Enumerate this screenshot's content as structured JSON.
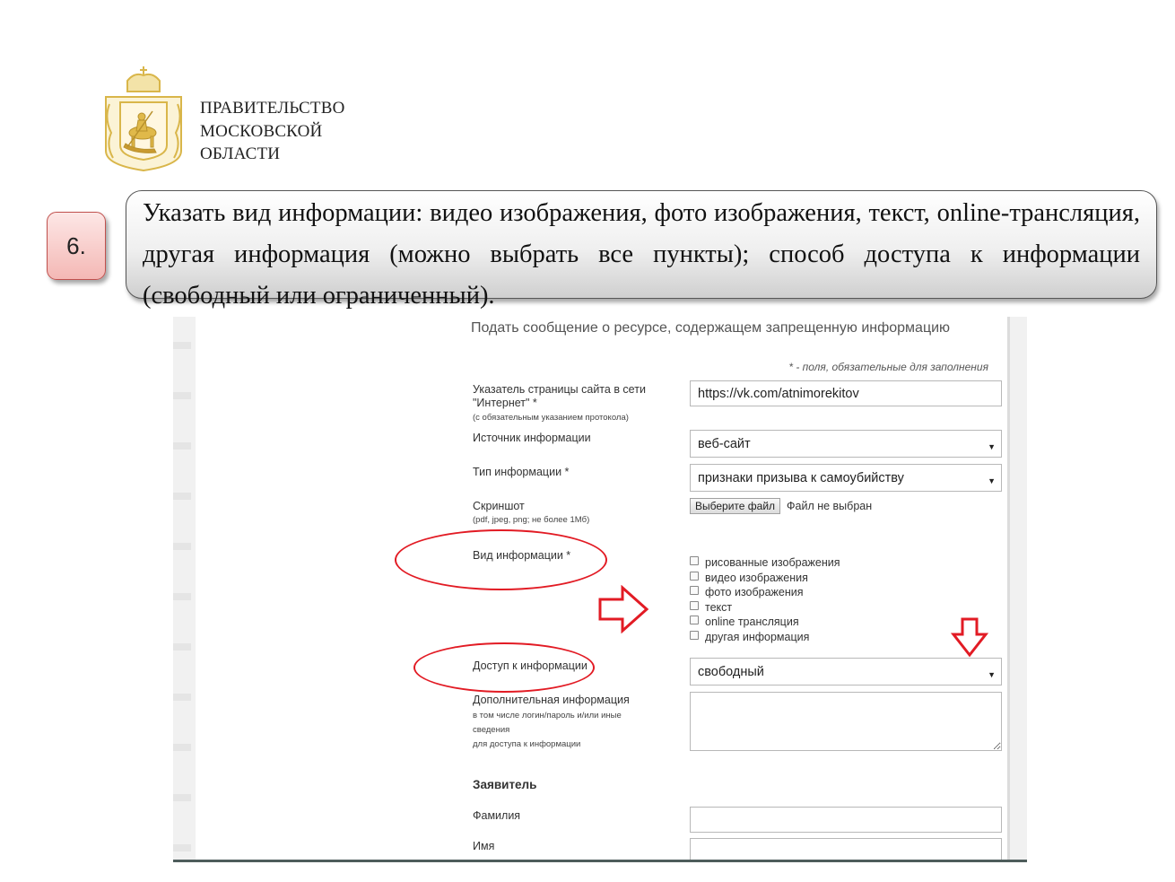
{
  "header": {
    "org_lines": [
      "ПРАВИТЕЛЬСТВО",
      "МОСКОВСКОЙ",
      "ОБЛАСТИ"
    ]
  },
  "step": {
    "number": "6.",
    "instruction": "Указать вид информации: видео изображения, фото изображения, текст, online-трансляция, другая информация (можно выбрать все пункты); способ доступа к информации (свободный или ограниченный)."
  },
  "form": {
    "title": "Подать сообщение о ресурсе, содержащем запрещенную информацию",
    "required_note": "* - поля, обязательные для заполнения",
    "url": {
      "label_line1": "Указатель страницы сайта в сети",
      "label_line2": "\"Интернет\" *",
      "hint": "(с обязательным указанием протокола)",
      "value": "https://vk.com/atnimorekitov"
    },
    "source": {
      "label": "Источник информации",
      "value": "веб-сайт"
    },
    "type": {
      "label": "Тип информации *",
      "value": "признаки призыва к самоубийству"
    },
    "screenshot": {
      "label": "Скриншот",
      "hint": "(pdf, jpeg, png; не более 1Мб)",
      "button": "Выберите файл",
      "status": "Файл не выбран"
    },
    "kind": {
      "label": "Вид информации *",
      "options": [
        "рисованные изображения",
        "видео изображения",
        "фото изображения",
        "текст",
        "online трансляция",
        "другая информация"
      ]
    },
    "access": {
      "label": "Доступ к информации",
      "value": "свободный"
    },
    "extra": {
      "label": "Дополнительная информация",
      "hint_lines": [
        "в том числе логин/пароль и/или иные",
        "сведения",
        "для доступа к информации"
      ]
    },
    "applicant": {
      "heading": "Заявитель",
      "surname_label": "Фамилия",
      "name_label": "Имя"
    }
  },
  "colors": {
    "annotation_red": "#e21b24",
    "badge_border": "#c0504d",
    "logo_gold": "#d9b64a"
  }
}
